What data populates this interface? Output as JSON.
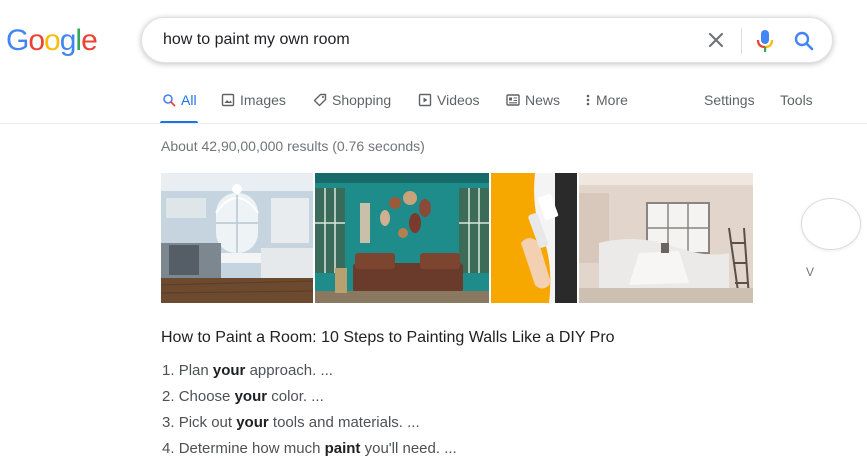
{
  "logo": {
    "text": "Google",
    "letters": [
      "G",
      "o",
      "o",
      "g",
      "l",
      "e"
    ],
    "letter_colors": [
      "#4285F4",
      "#EA4335",
      "#FBBC05",
      "#4285F4",
      "#34A853",
      "#EA4335"
    ]
  },
  "search": {
    "query": "how to paint my own room",
    "clear_icon": "close-icon",
    "mic_icon": "mic-icon",
    "search_icon": "search-icon"
  },
  "tabs": [
    {
      "label": "All",
      "icon": "search-icon",
      "active": true
    },
    {
      "label": "Images",
      "icon": "image-icon",
      "active": false
    },
    {
      "label": "Shopping",
      "icon": "tag-icon",
      "active": false
    },
    {
      "label": "Videos",
      "icon": "play-icon",
      "active": false
    },
    {
      "label": "News",
      "icon": "news-icon",
      "active": false
    },
    {
      "label": "More",
      "icon": "dots-vertical-icon",
      "active": false
    }
  ],
  "tools": {
    "settings": "Settings",
    "tools": "Tools"
  },
  "result_stats": "About 42,90,00,000 results (0.76 seconds)",
  "images": {
    "items": [
      {
        "description": "kitchen-photo"
      },
      {
        "description": "teal-living-room-photo"
      },
      {
        "description": "painting-yellow-wall-photo"
      },
      {
        "description": "covered-furniture-room-photo"
      }
    ],
    "more_label": "V"
  },
  "snippet": {
    "title": "How to Paint a Room: 10 Steps to Painting Walls Like a DIY Pro",
    "steps": [
      {
        "num": "1.",
        "before": "Plan ",
        "bold": "your",
        "after": " approach. ..."
      },
      {
        "num": "2.",
        "before": "Choose ",
        "bold": "your",
        "after": " color. ..."
      },
      {
        "num": "3.",
        "before": "Pick out ",
        "bold": "your",
        "after": " tools and materials. ..."
      },
      {
        "num": "4.",
        "before": "Determine how much ",
        "bold": "paint",
        "after": " you'll need. ..."
      }
    ]
  },
  "colors": {
    "accent": "#1a73e8",
    "text": "#202124",
    "muted": "#70757a"
  }
}
